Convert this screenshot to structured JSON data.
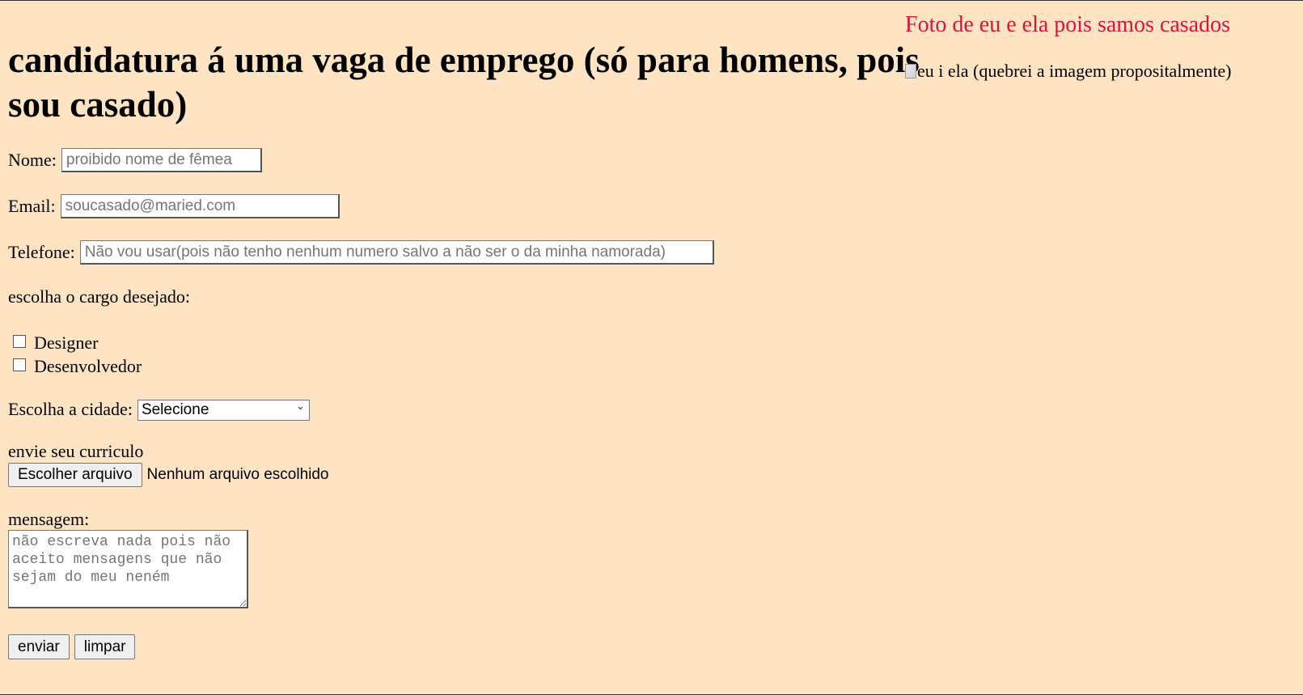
{
  "form": {
    "heading": "candidatura á uma vaga de emprego (só para homens, pois sou casado)",
    "name_label": "Nome:",
    "name_placeholder": "proibido nome de fêmea",
    "email_label": "Email:",
    "email_placeholder": "soucasado@maried.com",
    "phone_label": "Telefone:",
    "phone_placeholder": "Não vou usar(pois não tenho nenhum numero salvo a não ser o da minha namorada)",
    "role_prompt": "escolha o cargo desejado:",
    "roles": [
      {
        "label": "Designer",
        "checked": false
      },
      {
        "label": "Desenvolvedor",
        "checked": false
      }
    ],
    "city_label": "Escolha a cidade:",
    "city_selected": "Selecione",
    "resume_label": "envie seu curriculo",
    "file_button_label": "Escolher arquivo",
    "file_status": "Nenhum arquivo escolhido",
    "message_label": "mensagem:",
    "message_placeholder": "não escreva nada pois não aceito mensagens que não sejam do meu neném",
    "submit_label": "enviar",
    "reset_label": "limpar"
  },
  "aside": {
    "photo_title": "Foto de eu e ela pois samos casados",
    "image_alt": "eu i ela (quebrei a imagem propositalmente)"
  },
  "colors": {
    "background": "#ffe4c4",
    "photo_title": "#dc143c"
  },
  "icons": {
    "broken_image": "broken-image-icon",
    "select_chevron": "chevron-down-icon"
  }
}
